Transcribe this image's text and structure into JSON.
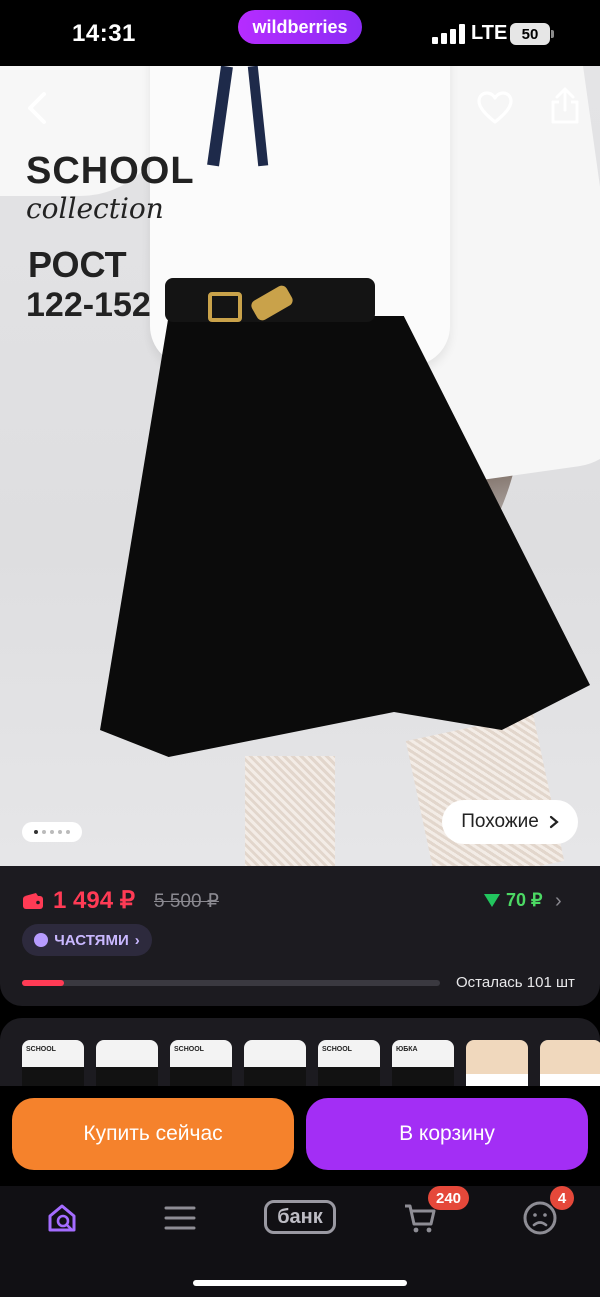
{
  "status_bar": {
    "time": "14:31",
    "brand": "wildberries",
    "network": "LTE",
    "battery": "50"
  },
  "hero": {
    "banner_line1": "SCHOOL",
    "banner_line2": "collection",
    "banner_line3": "РОСТ",
    "banner_line4": "122-152",
    "similar_label": "Похожие",
    "image_count": 5,
    "current_image": 1
  },
  "price": {
    "current": "1 494 ₽",
    "old": "5 500 ₽",
    "cashback": "70 ₽",
    "installments_label": "ЧАСТЯМИ",
    "stock_label": "Осталась 101 шт",
    "stock_fraction": 0.1
  },
  "thumbnails": [
    {
      "caption": "SCHOOL"
    },
    {
      "caption": ""
    },
    {
      "caption": "SCHOOL"
    },
    {
      "caption": ""
    },
    {
      "caption": "SCHOOL"
    },
    {
      "caption": "ЮБКА"
    },
    {
      "caption": ""
    },
    {
      "caption": ""
    }
  ],
  "actions": {
    "buy_now": "Купить сейчас",
    "add_to_cart": "В корзину"
  },
  "tab_bar": {
    "bank_label": "банк",
    "cart_badge": "240",
    "profile_badge": "4"
  },
  "colors": {
    "accent_purple": "#a32ef5",
    "accent_orange": "#f5822c",
    "price_red": "#ff3b55",
    "cashback_green": "#22c55e"
  }
}
